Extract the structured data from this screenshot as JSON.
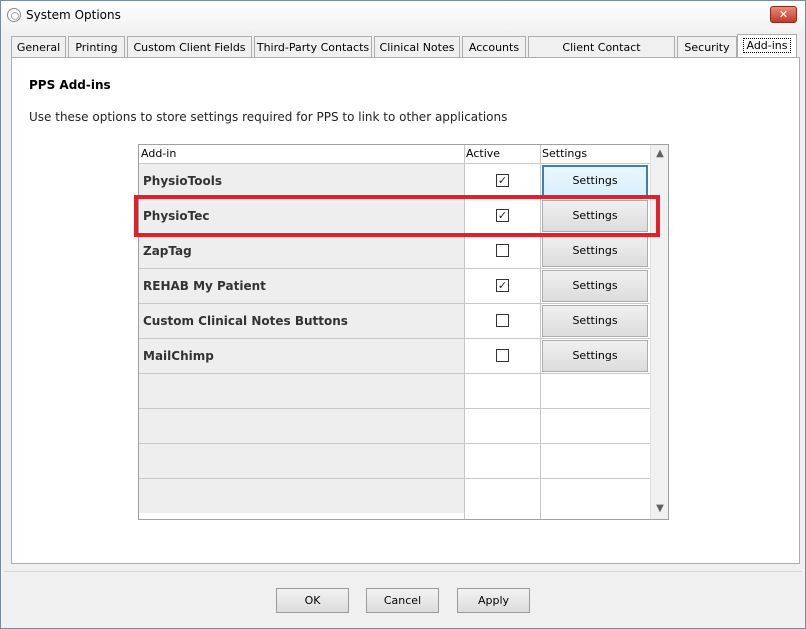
{
  "window": {
    "title": "System Options",
    "close_glyph": "✕"
  },
  "tabs": [
    {
      "label": "General",
      "active": false
    },
    {
      "label": "Printing",
      "active": false
    },
    {
      "label": "Custom Client Fields",
      "active": false
    },
    {
      "label": "Third-Party Contacts",
      "active": false
    },
    {
      "label": "Clinical Notes",
      "active": false
    },
    {
      "label": "Accounts",
      "active": false
    },
    {
      "label": "Client Contact Preferences",
      "active": false
    },
    {
      "label": "Security",
      "active": false
    },
    {
      "label": "Add-ins",
      "active": true
    }
  ],
  "panel": {
    "title": "PPS Add-ins",
    "description": "Use these options to store settings required for PPS to link to other applications"
  },
  "grid": {
    "columns": [
      "Add-in",
      "Active",
      "Settings"
    ],
    "rows": [
      {
        "name": "PhysioTools",
        "active": true,
        "settings_label": "Settings"
      },
      {
        "name": "PhysioTec",
        "active": true,
        "settings_label": "Settings"
      },
      {
        "name": "ZapTag",
        "active": false,
        "settings_label": "Settings"
      },
      {
        "name": "REHAB My Patient",
        "active": true,
        "settings_label": "Settings"
      },
      {
        "name": "Custom Clinical Notes Buttons",
        "active": false,
        "settings_label": "Settings"
      },
      {
        "name": "MailChimp",
        "active": false,
        "settings_label": "Settings"
      }
    ],
    "empty_rows": 4,
    "highlight_color": "#e0202a",
    "check_glyph": "✓",
    "scroll_up_glyph": "▲",
    "scroll_down_glyph": "▼"
  },
  "buttons": {
    "ok": "OK",
    "cancel": "Cancel",
    "apply": "Apply"
  }
}
